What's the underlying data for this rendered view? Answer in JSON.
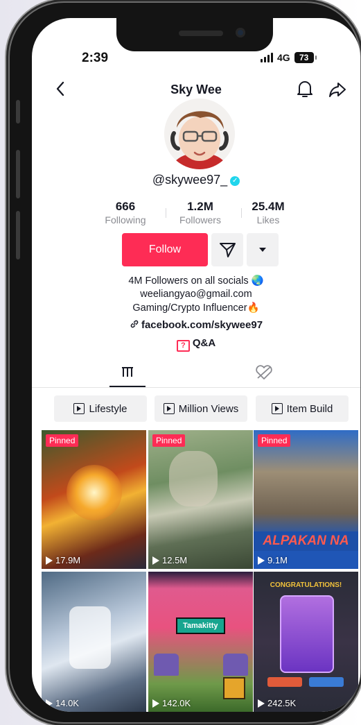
{
  "status": {
    "time": "2:39",
    "network": "4G",
    "battery": "73"
  },
  "header": {
    "title": "Sky Wee"
  },
  "profile": {
    "username": "@skywee97_"
  },
  "stats": [
    {
      "value": "666",
      "label": "Following"
    },
    {
      "value": "1.2M",
      "label": "Followers"
    },
    {
      "value": "25.4M",
      "label": "Likes"
    }
  ],
  "actions": {
    "follow_label": "Follow"
  },
  "bio": {
    "line1": "4M Followers on all socials 🌏",
    "line2": "weeliangyao@gmail.com",
    "line3": "Gaming/Crypto Influencer🔥",
    "link": "facebook.com/skywee97",
    "qa": "Q&A"
  },
  "playlists": [
    "Lifestyle",
    "Million Views",
    "Item Build"
  ],
  "videos": [
    {
      "pinned": "Pinned",
      "views": "17.9M",
      "overlay": ""
    },
    {
      "pinned": "Pinned",
      "views": "12.5M",
      "overlay": ""
    },
    {
      "pinned": "Pinned",
      "views": "9.1M",
      "overlay": "ALPAKAN NA"
    },
    {
      "pinned": "",
      "views": "14.0K",
      "overlay": ""
    },
    {
      "pinned": "",
      "views": "142.0K",
      "overlay": "Tamakitty"
    },
    {
      "pinned": "",
      "views": "242.5K",
      "overlay": "CONGRATULATIONS!"
    }
  ],
  "colors": {
    "accent": "#fe2c55",
    "verified": "#20d5ec",
    "text": "#161823"
  }
}
